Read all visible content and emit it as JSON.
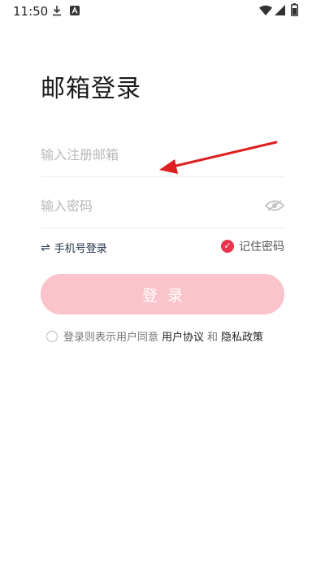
{
  "status_bar": {
    "time": "11:50",
    "icons": [
      "download-icon",
      "app-a-icon",
      "wifi-icon",
      "signal-icon",
      "battery-icon"
    ]
  },
  "page": {
    "title": "邮箱登录"
  },
  "email_field": {
    "placeholder": "输入注册邮箱",
    "value": ""
  },
  "password_field": {
    "placeholder": "输入密码",
    "value": "",
    "visibility_icon": "eye-hidden-icon"
  },
  "phone_login": {
    "icon": "swap-icon",
    "label": "手机号登录"
  },
  "remember_password": {
    "label": "记住密码",
    "checked": true
  },
  "login_button": {
    "label": "登录"
  },
  "agreement": {
    "prefix": "登录则表示用户同意",
    "user_agreement": "用户协议",
    "and": "和",
    "privacy_policy": "隐私政策",
    "checked": false
  },
  "colors": {
    "accent": "#e8334d",
    "button_disabled": "#fbc3cb",
    "annotation_arrow": "#e02020"
  }
}
